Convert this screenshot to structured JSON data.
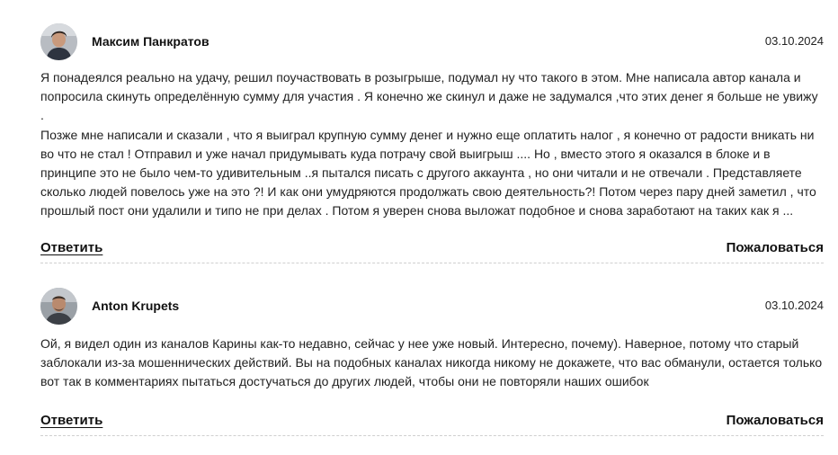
{
  "comments": [
    {
      "author": "Максим Панкратов",
      "date": "03.10.2024",
      "text": "Я понадеялся реально на удачу, решил поучаствовать в розыгрыше, подумал ну что такого в этом. Мне написала автор канала и\nпопросила скинуть определённую сумму для участия . Я конечно же скинул и даже не задумался ,что этих денег я больше не увижу .\nПозже мне написали и сказали , что я выиграл крупную сумму денег и нужно еще оплатить налог , я конечно от радости вникать ни\nво что не стал ! Отправил и уже начал придумывать куда потрачу свой выигрыш .... Но , вместо этого я оказался в блоке и в\nпринципе это не было чем-то удивительным ..я пытался писать с другого аккаунта , но они читали и не отвечали . Представляете\nсколько людей повелось уже на это ?! И как они умудряются продолжать свою деятельность?! Потом через пару дней заметил , что\nпрошлый пост они удалили и типо не при делах . Потом я уверен снова выложат подобное и снова заработают на таких как я ...",
      "reply_label": "Ответить",
      "report_label": "Пожаловаться"
    },
    {
      "author": "Anton Krupets",
      "date": "03.10.2024",
      "text": "Ой, я видел один из каналов Карины как-то недавно, сейчас у нее уже новый. Интересно, почему). Наверное, потому что старый\nзаблокали из-за мошеннических действий. Вы на подобных каналах никогда никому не докажете, что вас обманули, остается только\nвот так в комментариях пытаться достучаться до других людей, чтобы они не повторяли наших ошибок",
      "reply_label": "Ответить",
      "report_label": "Пожаловаться"
    }
  ]
}
